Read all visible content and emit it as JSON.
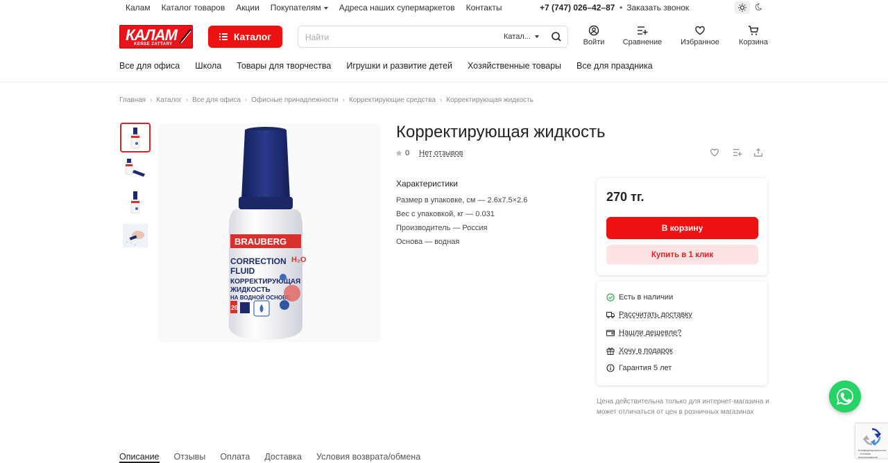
{
  "topbar": {
    "nav": [
      "Калам",
      "Каталог товаров",
      "Акции",
      "Покупателям",
      "Адреса наших супермаркетов",
      "Контакты"
    ],
    "phone": "+7 (747) 026–42–87",
    "callback": "Заказать звонок"
  },
  "header": {
    "logo_text": "КАЛАМ",
    "logo_sub": "KEŃSE ZATTARY",
    "catalog_button": "Каталог",
    "search_placeholder": "Найти",
    "search_scope": "Катал...",
    "icons": {
      "login": "Войти",
      "compare": "Сравнение",
      "favorites": "Избранное",
      "cart": "Корзина"
    }
  },
  "catnav": [
    "Все для офиса",
    "Школа",
    "Товары для творчества",
    "Игрушки и развитие детей",
    "Хозяйственные товары",
    "Все для праздника"
  ],
  "breadcrumbs": [
    "Главная",
    "Каталог",
    "Все для офиса",
    "Офисные принадлежности",
    "Корректирующие средства",
    "Корректирующая жидкость"
  ],
  "product": {
    "title": "Корректирующая жидкость",
    "rating": "0",
    "reviews": "Нет отзывов",
    "chars_title": "Характеристики",
    "chars": [
      "Размер в упаковке, см — 2.6x7.5×2.6",
      "Вес с упаковкой, кг — 0.031",
      "Производитель — Россия",
      "Основа — водная"
    ],
    "image": {
      "brand": "BRAUBERG",
      "line1": "CORRECTION",
      "line2": "FLUID",
      "line3": "КОРРЕКТИРУЮЩАЯ",
      "line4": "ЖИДКОСТЬ",
      "line5": "НА ВОДНОЙ ОСНОВЕ",
      "h2o": "H₂O",
      "ml": "20"
    }
  },
  "buy": {
    "price": "270 тг.",
    "cart_button": "В корзину",
    "one_click": "Купить в 1 клик"
  },
  "info": [
    "Есть в наличии",
    "Рассчитать доставку",
    "Нашли дешевле?",
    "Хочу в подарок",
    "Гарантия 5 лет"
  ],
  "note": "Цена действительна только для интернет-магазина и может отличаться от цен в розничных магазинах",
  "tabs": [
    "Описание",
    "Отзывы",
    "Оплата",
    "Доставка",
    "Условия возврата/обмена"
  ],
  "recaptcha_text": "Конфиденциальность - Условия использования",
  "colors": {
    "accent": "#ee1111",
    "accent_light": "#fde3e3",
    "whatsapp": "#25d366"
  }
}
